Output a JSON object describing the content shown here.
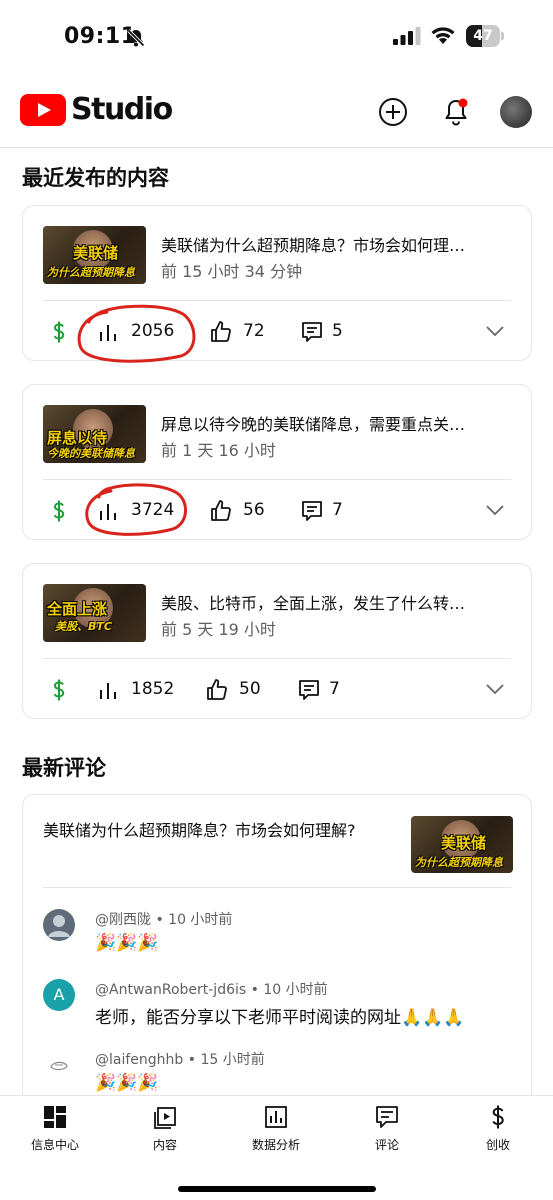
{
  "status_bar": {
    "time": "09:11",
    "battery": "47",
    "battery_level": 0.47
  },
  "header": {
    "logo_text": "Studio",
    "brand_color": "#ff0000",
    "notification_color": "#ff0000"
  },
  "recent": {
    "title": "最近发布的内容",
    "videos": [
      {
        "title": "美联储为什么超预期降息？市场会如何理…",
        "time": "前 15 小时 34 分钟",
        "views": "2056",
        "likes": "72",
        "comments": "5",
        "thumb_line1": "美联储",
        "thumb_line2": "为什么超预期降息"
      },
      {
        "title": "屏息以待今晚的美联储降息，需要重点关…",
        "time": "前 1 天 16 小时",
        "views": "3724",
        "likes": "56",
        "comments": "7",
        "thumb_line1": "屏息以待",
        "thumb_line2": "今晚的美联储降息"
      },
      {
        "title": "美股、比特币，全面上涨，发生了什么转…",
        "time": "前 5 天 19 小时",
        "views": "1852",
        "likes": "50",
        "comments": "7",
        "thumb_line1": "全面上涨",
        "thumb_line2": "美股、BTC"
      }
    ]
  },
  "latest_comments": {
    "title": "最新评论",
    "video_title": "美联储为什么超预期降息？市场会如何理解?",
    "thumb_line1": "美联储",
    "thumb_line2": "为什么超预期降息",
    "comments": [
      {
        "author": "@刚西陇",
        "time": "10 小时前",
        "text": "🎉🎉🎉",
        "avatar_color": "#5f6b78",
        "avatar_letter": ""
      },
      {
        "author": "@AntwanRobert-jd6is",
        "time": "10 小时前",
        "text": "老师，能否分享以下老师平时阅读的网址🙏🙏🙏",
        "avatar_color": "#1aa0a8",
        "avatar_letter": "A"
      },
      {
        "author": "@laifenghhb",
        "time": "15 小时前",
        "text": "🎉🎉🎉",
        "avatar_color": "#ffffff",
        "avatar_letter": ""
      }
    ]
  },
  "nav": {
    "items": [
      {
        "label": "信息中心",
        "icon": "dashboard-icon"
      },
      {
        "label": "内容",
        "icon": "content-icon"
      },
      {
        "label": "数据分析",
        "icon": "analytics-icon"
      },
      {
        "label": "评论",
        "icon": "comments-icon"
      },
      {
        "label": "创收",
        "icon": "earn-icon"
      }
    ]
  },
  "colors": {
    "dollar_green": "#1e9e3a",
    "annotation_red": "#d8241c"
  }
}
